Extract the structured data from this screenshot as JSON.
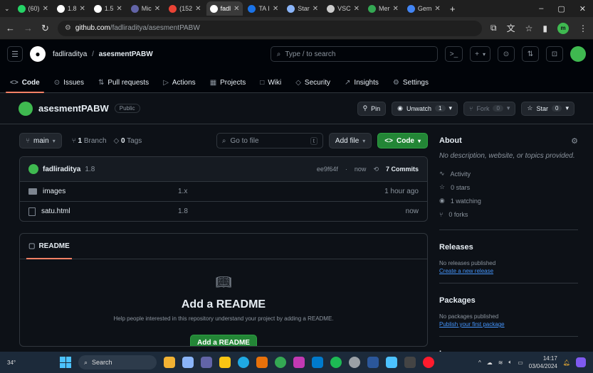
{
  "browser": {
    "tabs": [
      {
        "label": "(60)",
        "color": "#25d366"
      },
      {
        "label": "1.8",
        "color": "#ffffff"
      },
      {
        "label": "1.5",
        "color": "#ffffff"
      },
      {
        "label": "Mic",
        "color": "#6264a7"
      },
      {
        "label": "(152",
        "color": "#ea4335"
      },
      {
        "label": "fadl",
        "color": "#ffffff",
        "active": true
      },
      {
        "label": "TA I",
        "color": "#1a73e8"
      },
      {
        "label": "Star",
        "color": "#8ab4f8"
      },
      {
        "label": "VSC",
        "color": "#cccccc"
      },
      {
        "label": "Mer",
        "color": "#34a853"
      },
      {
        "label": "Gem",
        "color": "#4285f4"
      }
    ],
    "new_tab": "+",
    "url_domain": "github.com",
    "url_path": "/fadliraditya/asesmentPABW",
    "profile_initial": "m"
  },
  "header": {
    "owner": "fadliraditya",
    "separator": "/",
    "repo": "asesmentPABW",
    "search_placeholder": "Type / to search",
    "plus": "+",
    "plus_caret": "▾"
  },
  "reponav": [
    {
      "label": "Code",
      "icon": "<>",
      "active": true
    },
    {
      "label": "Issues",
      "icon": "⊙"
    },
    {
      "label": "Pull requests",
      "icon": "⇅"
    },
    {
      "label": "Actions",
      "icon": "▷"
    },
    {
      "label": "Projects",
      "icon": "▦"
    },
    {
      "label": "Wiki",
      "icon": "□"
    },
    {
      "label": "Security",
      "icon": "◇"
    },
    {
      "label": "Insights",
      "icon": "↗"
    },
    {
      "label": "Settings",
      "icon": "⚙"
    }
  ],
  "repo": {
    "name": "asesmentPABW",
    "visibility": "Public",
    "pin": "Pin",
    "unwatch": "Unwatch",
    "unwatch_count": "1",
    "fork": "Fork",
    "fork_count": "0",
    "star": "Star",
    "star_count": "0"
  },
  "filebar": {
    "branch": "main",
    "branches": "1",
    "branches_label": "Branch",
    "tags": "0",
    "tags_label": "Tags",
    "goto": "Go to file",
    "goto_key": "t",
    "add_file": "Add file",
    "code": "Code"
  },
  "commit": {
    "author": "fadliraditya",
    "message": "1.8",
    "hash": "ee9f64f",
    "sep": "·",
    "time": "now",
    "commits": "7 Commits"
  },
  "files": [
    {
      "name": "images",
      "type": "folder",
      "message": "1.x",
      "time": "1 hour ago"
    },
    {
      "name": "satu.html",
      "type": "file",
      "message": "1.8",
      "time": "now"
    }
  ],
  "readme": {
    "tab": "README",
    "title": "Add a README",
    "desc": "Help people interested in this repository understand your project by adding a README.",
    "button": "Add a README"
  },
  "about": {
    "title": "About",
    "desc": "No description, website, or topics provided.",
    "items": [
      {
        "icon": "∿",
        "label": "Activity"
      },
      {
        "icon": "☆",
        "label": "0 stars"
      },
      {
        "icon": "◉",
        "label": "1 watching"
      },
      {
        "icon": "⑂",
        "label": "0 forks"
      }
    ],
    "releases_title": "Releases",
    "releases_text": "No releases published",
    "releases_link": "Create a new release",
    "packages_title": "Packages",
    "packages_text": "No packages published",
    "packages_link": "Publish your first package",
    "languages_title": "Languages"
  },
  "taskbar": {
    "temp": "34°",
    "search": "Search",
    "time": "14:17",
    "date": "03/04/2024"
  }
}
